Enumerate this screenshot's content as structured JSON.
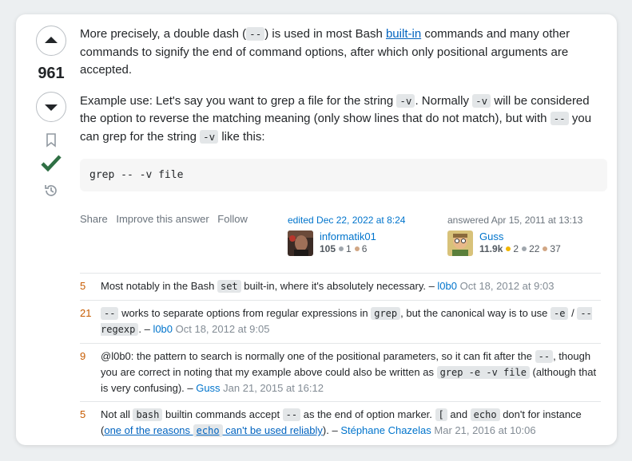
{
  "vote": {
    "count": "961"
  },
  "post": {
    "p1": {
      "t1": "More precisely, a double dash (",
      "c1": "--",
      "t2": ") is used in most Bash ",
      "link": "built-in",
      "t3": " commands and many other commands to signify the end of command options, after which only positional arguments are accepted."
    },
    "p2": {
      "t1": "Example use: Let's say you want to grep a file for the string ",
      "c1": "-v",
      "t2": ". Normally ",
      "c2": "-v",
      "t3": " will be considered the option to reverse the matching meaning (only show lines that do not match), but with ",
      "c3": "--",
      "t4": " you can grep for the string ",
      "c4": "-v",
      "t5": " like this:"
    },
    "code_block": "grep -- -v file"
  },
  "actions": {
    "share": "Share",
    "improve": "Improve this answer",
    "follow": "Follow"
  },
  "editor": {
    "label": "edited Dec 22, 2022 at 8:24",
    "name": "informatik01",
    "rep": "105",
    "silver": "1",
    "bronze": "6"
  },
  "author": {
    "label": "answered Apr 15, 2011 at 13:13",
    "name": "Guss",
    "rep": "11.9k",
    "gold": "2",
    "silver": "22",
    "bronze": "37"
  },
  "comments": [
    {
      "score": "5",
      "t1": "Most notably in the Bash ",
      "c1": "set",
      "t2": " built-in, where it's absolutely necessary. – ",
      "user": "l0b0",
      "date": " Oct 18, 2012 at 9:03"
    },
    {
      "score": "21",
      "c1": "--",
      "t1": " works to separate options from regular expressions in ",
      "c2": "grep",
      "t2": ", but the canonical way is to use ",
      "c3": "-e",
      "t3": " / ",
      "c4": "--regexp",
      "t4": ". – ",
      "user": "l0b0",
      "date": " Oct 18, 2012 at 9:05"
    },
    {
      "score": "9",
      "t1": "@l0b0: the pattern to search is normally one of the positional parameters, so it can fit after the ",
      "c1": "--",
      "t2": ", though you are correct in noting that my example above could also be written as ",
      "c2": "grep -e -v file",
      "t3": " (although that is very confusing). – ",
      "user": "Guss",
      "date": " Jan 21, 2015 at 16:12"
    },
    {
      "score": "5",
      "t1": "Not all ",
      "c1": "bash",
      "t2": " builtin commands accept ",
      "c2": "--",
      "t3": " as the end of option marker. ",
      "c3": "[",
      "t4": " and ",
      "c4": "echo",
      "t5": " don't for instance (",
      "l1": "one of the reasons ",
      "lc": "echo",
      "l2": " can't be used reliably",
      "t6": "). – ",
      "user": "Stéphane Chazelas",
      "date": " Mar 21, 2016 at 10:06"
    }
  ],
  "colors": {
    "accent": "#0074cc",
    "accepted": "#2f6f44",
    "score": "#c75b00",
    "gold": "#f1b600",
    "silver": "#9fa6ad",
    "bronze": "#d1a684"
  },
  "icons": [
    "arrow-up-icon",
    "arrow-down-icon",
    "bookmark-icon",
    "accepted-check-icon",
    "history-icon"
  ]
}
